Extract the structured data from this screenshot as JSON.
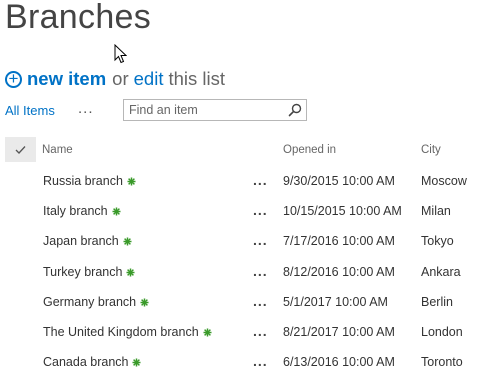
{
  "page": {
    "title": "Branches"
  },
  "command_bar": {
    "new_item_label": "new item",
    "or_text": "or",
    "edit_label": "edit",
    "this_list_text": "this list"
  },
  "view_bar": {
    "view_label": "All Items",
    "more_label": "...",
    "search": {
      "placeholder": "Find an item",
      "value": ""
    }
  },
  "table": {
    "columns": [
      "Name",
      "Opened in",
      "City"
    ],
    "rows": [
      {
        "name": "Russia branch",
        "opened": "9/30/2015 10:00 AM",
        "city": "Moscow"
      },
      {
        "name": "Italy branch",
        "opened": "10/15/2015 10:00 AM",
        "city": "Milan"
      },
      {
        "name": "Japan branch",
        "opened": "7/17/2016 10:00 AM",
        "city": "Tokyo"
      },
      {
        "name": "Turkey branch",
        "opened": "8/12/2016 10:00 AM",
        "city": "Ankara"
      },
      {
        "name": "Germany branch",
        "opened": "5/1/2017 10:00 AM",
        "city": "Berlin"
      },
      {
        "name": "The United Kingdom branch",
        "opened": "8/21/2017 10:00 AM",
        "city": "London"
      },
      {
        "name": "Canada branch",
        "opened": "6/13/2016 10:00 AM",
        "city": "Toronto"
      }
    ],
    "row_menu_label": "..."
  },
  "icons": {
    "add": "plus-circle-icon",
    "search": "magnifier-icon",
    "select_all": "checkmark-icon",
    "new_item_marker": "green-asterisk-icon",
    "cursor": "mouse-pointer-icon"
  },
  "colors": {
    "accent": "#0072c6",
    "new_marker": "#3a9a2a",
    "header_check_bg": "#eaeaea"
  }
}
